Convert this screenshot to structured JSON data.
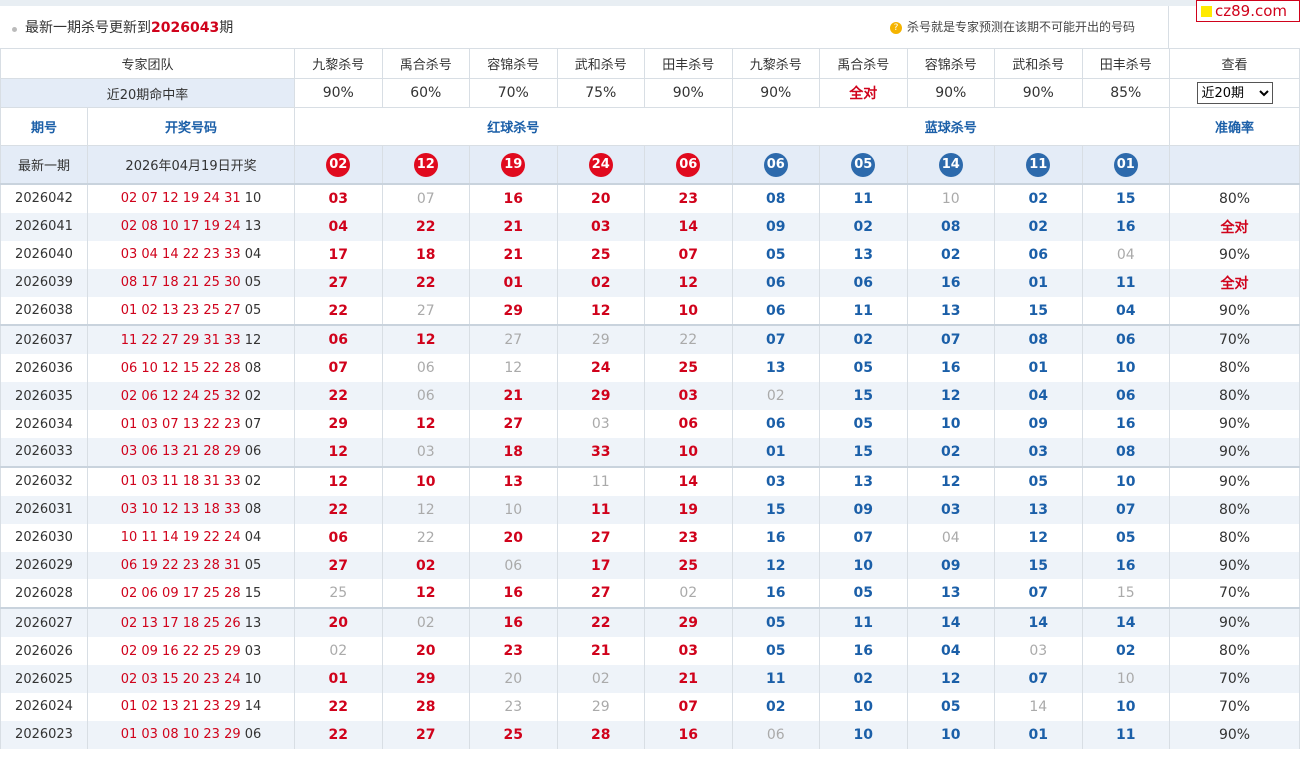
{
  "header": {
    "prefix": "最新一期杀号更新到",
    "issue": "2026043",
    "suffix": "期",
    "note": "杀号就是专家预测在该期不可能开出的号码",
    "note_icon": "question-icon"
  },
  "logo": {
    "text": "cz89.com"
  },
  "team_row": {
    "label": "专家团队",
    "experts": [
      "九黎杀号",
      "禹合杀号",
      "容锦杀号",
      "武和杀号",
      "田丰杀号",
      "九黎杀号",
      "禹合杀号",
      "容锦杀号",
      "武和杀号",
      "田丰杀号"
    ],
    "view_label": "查看"
  },
  "rate_row": {
    "label": "近20期命中率",
    "rates": [
      "90%",
      "60%",
      "70%",
      "75%",
      "90%",
      "90%",
      "全对",
      "90%",
      "90%",
      "85%"
    ],
    "select_value": "近20期",
    "select_options": [
      "近20期"
    ]
  },
  "columns": {
    "issue": "期号",
    "draw": "开奖号码",
    "red": "红球杀号",
    "blue": "蓝球杀号",
    "accuracy": "准确率"
  },
  "latest": {
    "label": "最新一期",
    "date": "2026年04月19日开奖",
    "red_kills": [
      "02",
      "12",
      "19",
      "24",
      "06"
    ],
    "blue_kills": [
      "06",
      "05",
      "14",
      "11",
      "01"
    ]
  },
  "rows": [
    {
      "issue": "2026042",
      "red": "02 07 12 19 24 31",
      "blue": "10",
      "kills": [
        "03",
        "07",
        "16",
        "20",
        "23",
        "08",
        "11",
        "10",
        "02",
        "15"
      ],
      "miss": [
        1,
        7
      ],
      "acc": "80%"
    },
    {
      "issue": "2026041",
      "red": "02 08 10 17 19 24",
      "blue": "13",
      "kills": [
        "04",
        "22",
        "21",
        "03",
        "14",
        "09",
        "02",
        "08",
        "02",
        "16"
      ],
      "miss": [],
      "acc": "全对"
    },
    {
      "issue": "2026040",
      "red": "03 04 14 22 23 33",
      "blue": "04",
      "kills": [
        "17",
        "18",
        "21",
        "25",
        "07",
        "05",
        "13",
        "02",
        "06",
        "04"
      ],
      "miss": [
        9
      ],
      "acc": "90%"
    },
    {
      "issue": "2026039",
      "red": "08 17 18 21 25 30",
      "blue": "05",
      "kills": [
        "27",
        "22",
        "01",
        "02",
        "12",
        "06",
        "06",
        "16",
        "01",
        "11"
      ],
      "miss": [],
      "acc": "全对"
    },
    {
      "issue": "2026038",
      "red": "01 02 13 23 25 27",
      "blue": "05",
      "kills": [
        "22",
        "27",
        "29",
        "12",
        "10",
        "06",
        "11",
        "13",
        "15",
        "04"
      ],
      "miss": [
        1
      ],
      "acc": "90%"
    },
    {
      "issue": "2026037",
      "red": "11 22 27 29 31 33",
      "blue": "12",
      "kills": [
        "06",
        "12",
        "27",
        "29",
        "22",
        "07",
        "02",
        "07",
        "08",
        "06"
      ],
      "miss": [
        2,
        3,
        4
      ],
      "acc": "70%"
    },
    {
      "issue": "2026036",
      "red": "06 10 12 15 22 28",
      "blue": "08",
      "kills": [
        "07",
        "06",
        "12",
        "24",
        "25",
        "13",
        "05",
        "16",
        "01",
        "10"
      ],
      "miss": [
        1,
        2
      ],
      "acc": "80%"
    },
    {
      "issue": "2026035",
      "red": "02 06 12 24 25 32",
      "blue": "02",
      "kills": [
        "22",
        "06",
        "21",
        "29",
        "03",
        "02",
        "15",
        "12",
        "04",
        "06"
      ],
      "miss": [
        1,
        5
      ],
      "acc": "80%"
    },
    {
      "issue": "2026034",
      "red": "01 03 07 13 22 23",
      "blue": "07",
      "kills": [
        "29",
        "12",
        "27",
        "03",
        "06",
        "06",
        "05",
        "10",
        "09",
        "16"
      ],
      "miss": [
        3
      ],
      "acc": "90%"
    },
    {
      "issue": "2026033",
      "red": "03 06 13 21 28 29",
      "blue": "06",
      "kills": [
        "12",
        "03",
        "18",
        "33",
        "10",
        "01",
        "15",
        "02",
        "03",
        "08"
      ],
      "miss": [
        1
      ],
      "acc": "90%"
    },
    {
      "issue": "2026032",
      "red": "01 03 11 18 31 33",
      "blue": "02",
      "kills": [
        "12",
        "10",
        "13",
        "11",
        "14",
        "03",
        "13",
        "12",
        "05",
        "10"
      ],
      "miss": [
        3
      ],
      "acc": "90%"
    },
    {
      "issue": "2026031",
      "red": "03 10 12 13 18 33",
      "blue": "08",
      "kills": [
        "22",
        "12",
        "10",
        "11",
        "19",
        "15",
        "09",
        "03",
        "13",
        "07"
      ],
      "miss": [
        1,
        2
      ],
      "acc": "80%"
    },
    {
      "issue": "2026030",
      "red": "10 11 14 19 22 24",
      "blue": "04",
      "kills": [
        "06",
        "22",
        "20",
        "27",
        "23",
        "16",
        "07",
        "04",
        "12",
        "05"
      ],
      "miss": [
        1,
        7
      ],
      "acc": "80%"
    },
    {
      "issue": "2026029",
      "red": "06 19 22 23 28 31",
      "blue": "05",
      "kills": [
        "27",
        "02",
        "06",
        "17",
        "25",
        "12",
        "10",
        "09",
        "15",
        "16"
      ],
      "miss": [
        2
      ],
      "acc": "90%"
    },
    {
      "issue": "2026028",
      "red": "02 06 09 17 25 28",
      "blue": "15",
      "kills": [
        "25",
        "12",
        "16",
        "27",
        "02",
        "16",
        "05",
        "13",
        "07",
        "15"
      ],
      "miss": [
        0,
        4,
        9
      ],
      "acc": "70%"
    },
    {
      "issue": "2026027",
      "red": "02 13 17 18 25 26",
      "blue": "13",
      "kills": [
        "20",
        "02",
        "16",
        "22",
        "29",
        "05",
        "11",
        "14",
        "14",
        "14"
      ],
      "miss": [
        1
      ],
      "acc": "90%"
    },
    {
      "issue": "2026026",
      "red": "02 09 16 22 25 29",
      "blue": "03",
      "kills": [
        "02",
        "20",
        "23",
        "21",
        "03",
        "05",
        "16",
        "04",
        "03",
        "02"
      ],
      "miss": [
        0,
        8
      ],
      "acc": "80%"
    },
    {
      "issue": "2026025",
      "red": "02 03 15 20 23 24",
      "blue": "10",
      "kills": [
        "01",
        "29",
        "20",
        "02",
        "21",
        "11",
        "02",
        "12",
        "07",
        "10"
      ],
      "miss": [
        2,
        3,
        9
      ],
      "acc": "70%"
    },
    {
      "issue": "2026024",
      "red": "01 02 13 21 23 29",
      "blue": "14",
      "kills": [
        "22",
        "28",
        "23",
        "29",
        "07",
        "02",
        "10",
        "05",
        "14",
        "10"
      ],
      "miss": [
        2,
        3,
        8
      ],
      "acc": "70%"
    },
    {
      "issue": "2026023",
      "red": "01 03 08 10 23 29",
      "blue": "06",
      "kills": [
        "22",
        "27",
        "25",
        "28",
        "16",
        "06",
        "10",
        "10",
        "01",
        "11"
      ],
      "miss": [
        5
      ],
      "acc": "90%"
    }
  ]
}
